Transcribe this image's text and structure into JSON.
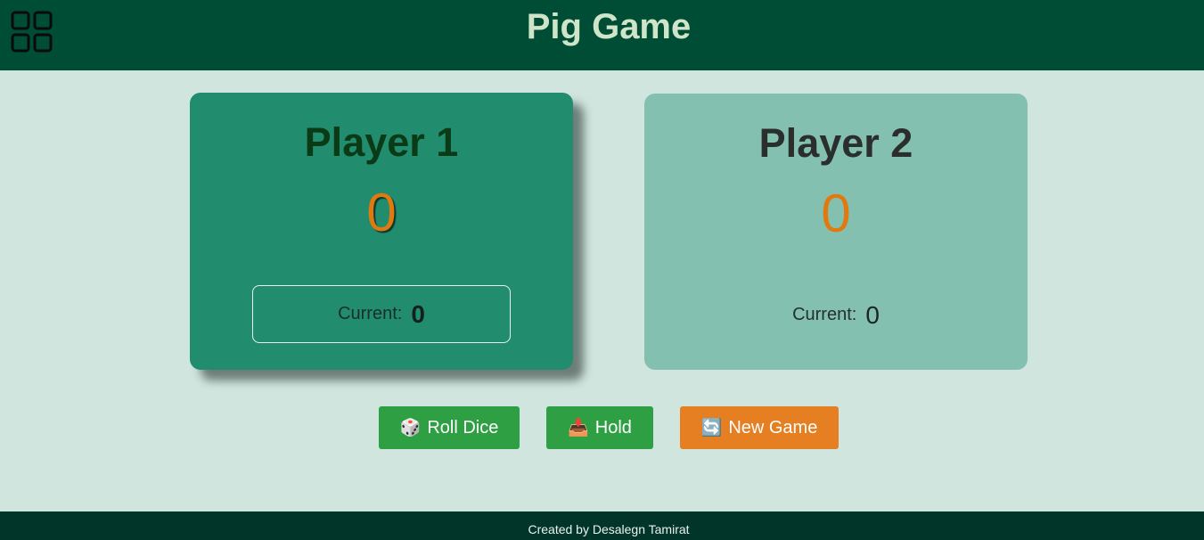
{
  "header": {
    "title": "Pig Game",
    "menu_icon": "grid-icon"
  },
  "players": [
    {
      "name": "Player 1",
      "score": "0",
      "current_label": "Current:",
      "current_value": "0",
      "active": true
    },
    {
      "name": "Player 2",
      "score": "0",
      "current_label": "Current:",
      "current_value": "0",
      "active": false
    }
  ],
  "controls": {
    "roll": {
      "icon": "🎲",
      "label": "Roll Dice"
    },
    "hold": {
      "icon": "📥",
      "label": "Hold"
    },
    "new_game": {
      "icon": "🔄",
      "label": "New Game"
    }
  },
  "footer": {
    "text": "Created by Desalegn Tamirat"
  },
  "colors": {
    "header_bg": "#004d36",
    "page_bg": "#cfe5de",
    "active_panel": "#218d6e",
    "inactive_panel": "#84c0af",
    "score": "#e07a10",
    "green_button": "#2ea043",
    "orange_button": "#e67e22",
    "footer_bg": "#02352a"
  }
}
